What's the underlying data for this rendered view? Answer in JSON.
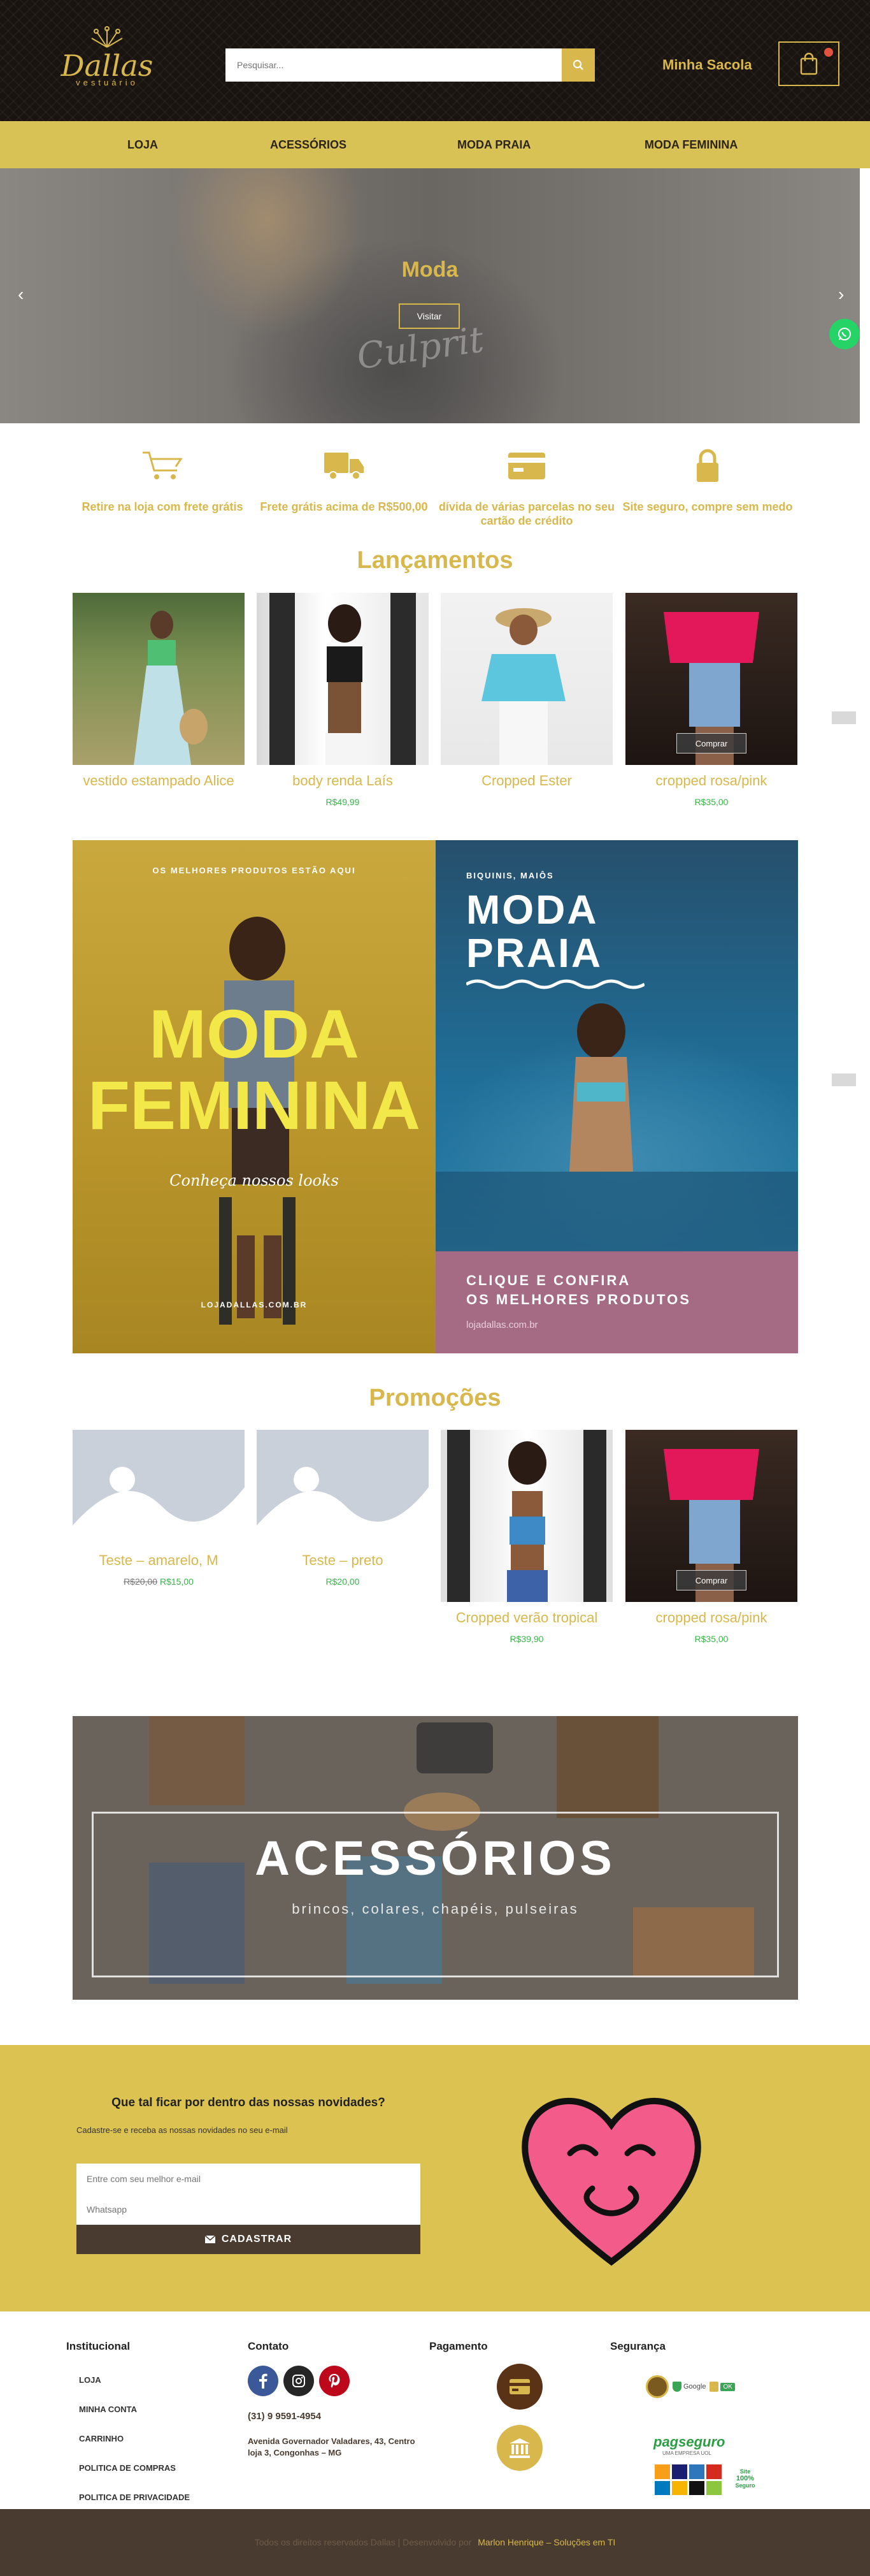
{
  "header": {
    "logo_name": "Dallas",
    "logo_sub": "vestuário",
    "search_placeholder": "Pesquisar...",
    "bag_label": "Minha Sacola",
    "accent": "#d8b84c"
  },
  "nav": [
    "LOJA",
    "ACESSÓRIOS",
    "MODA PRAIA",
    "MODA FEMININA"
  ],
  "hero": {
    "title": "Moda",
    "button": "Visitar",
    "shirt_text": "Culprit",
    "prev": "‹",
    "next": "›"
  },
  "features": [
    {
      "icon": "cart-icon",
      "text": "Retire na loja com frete grátis"
    },
    {
      "icon": "truck-icon",
      "text": "Frete grátis acima de R$500,00"
    },
    {
      "icon": "credit-card-icon",
      "text": "dívida de várias parcelas no seu cartão de crédito"
    },
    {
      "icon": "lock-icon",
      "text": "Site seguro, compre sem medo"
    }
  ],
  "launches": {
    "title": "Lançamentos",
    "products": [
      {
        "name": "vestido estampado Alice",
        "price": ""
      },
      {
        "name": "body renda Laís",
        "price": "R$49,99"
      },
      {
        "name": "Cropped Ester",
        "price": ""
      },
      {
        "name": "cropped rosa/pink",
        "price": "R$35,00",
        "button": "Comprar"
      }
    ]
  },
  "banners": {
    "left_top": "OS MELHORES PRODUTOS ESTÃO AQUI",
    "left_title_1": "MODA",
    "left_title_2": "FEMININA",
    "left_script": "Conheça nossos looks",
    "left_url": "LOJADALLAS.COM.BR",
    "right_top": "BIQUINIS, MAIÔS",
    "right_title_1": "MODA",
    "right_title_2": "PRAIA",
    "right_cta_1": "CLIQUE E CONFIRA",
    "right_cta_2": "OS MELHORES PRODUTOS",
    "right_url": "lojadallas.com.br"
  },
  "promotions": {
    "title": "Promoções",
    "products": [
      {
        "name": "Teste – amarelo, M",
        "old_price": "R$20,00",
        "price": "R$15,00"
      },
      {
        "name": "Teste – preto",
        "old_price": "",
        "price": "R$20,00"
      },
      {
        "name": "Cropped verão tropical",
        "old_price": "",
        "price": "R$39,90"
      },
      {
        "name": "cropped rosa/pink",
        "old_price": "",
        "price": "R$35,00",
        "button": "Comprar"
      }
    ]
  },
  "accessories_banner": {
    "title": "ACESSÓRIOS",
    "subtitle": "brincos, colares, chapéis, pulseiras"
  },
  "newsletter": {
    "title": "Que tal ficar por dentro das nossas novidades?",
    "subtitle": "Cadastre-se e receba as nossas novidades no seu e-mail",
    "email_placeholder": "Entre com seu melhor e-mail",
    "whatsapp_placeholder": "Whatsapp",
    "button": "CADASTRAR"
  },
  "footer": {
    "institucional": {
      "title": "Institucional",
      "links": [
        "LOJA",
        "MINHA CONTA",
        "CARRINHO",
        "POLITICA DE COMPRAS",
        "POLITICA DE PRIVACIDADE"
      ]
    },
    "contato": {
      "title": "Contato",
      "phone": "(31) 9 9591-4954",
      "address_1": "Avenida Governador Valadares, 43, Centro",
      "address_2": "loja 3, Congonhas – MG"
    },
    "pagamento": {
      "title": "Pagamento"
    },
    "seguranca": {
      "title": "Segurança",
      "badge_google": "Google",
      "badge_ok": "OK",
      "pagseguro": "pagseguro",
      "pagseguro_sub": "UMA EMPRESA UOL",
      "ssl_line1": "Site",
      "ssl_line2": "100%",
      "ssl_line3": "Seguro"
    }
  },
  "bottom": {
    "text": "Todos os direitos reservados Dallas | Desenvolvido por",
    "link": "Marlon Henrique – Soluções em TI"
  }
}
